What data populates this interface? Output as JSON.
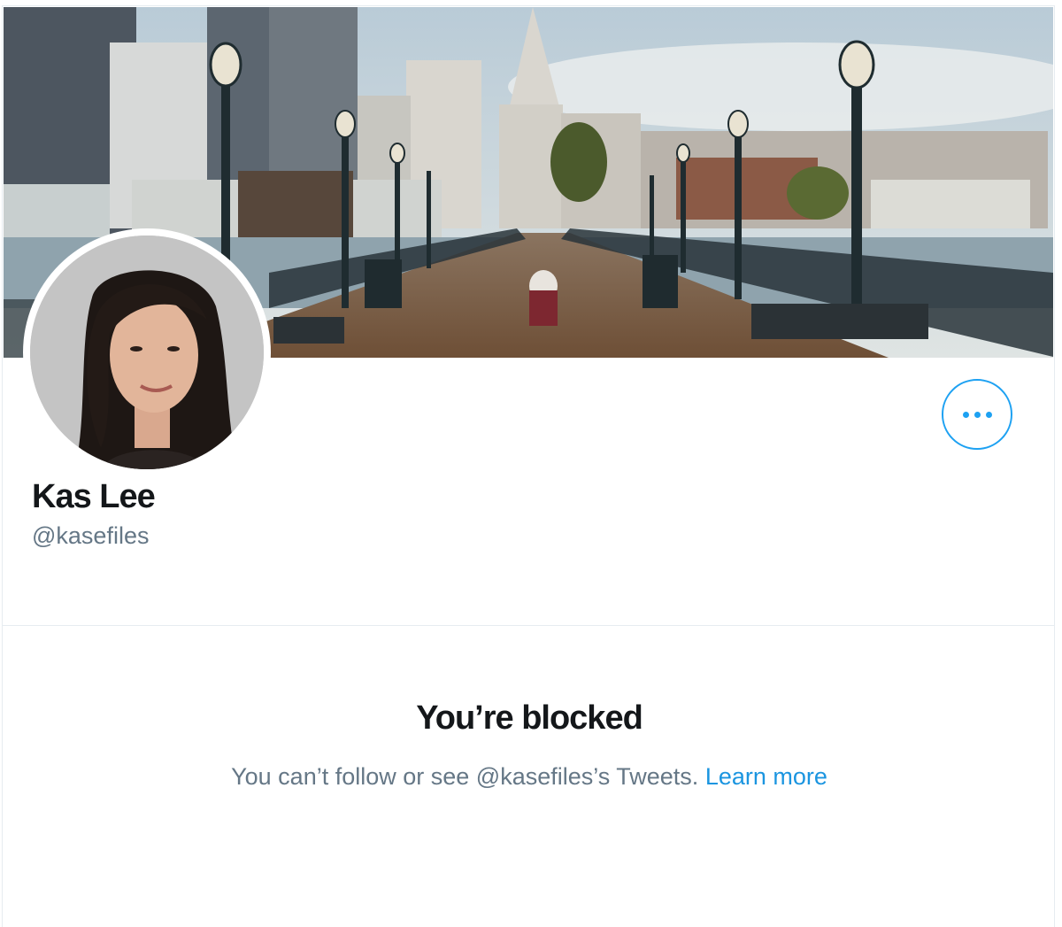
{
  "profile": {
    "name": "Kas Lee",
    "handle": "@kasefiles"
  },
  "actions": {
    "more_icon": "more-horizontal-icon"
  },
  "blocked": {
    "title": "You’re blocked",
    "message": "You can’t follow or see @kasefiles’s Tweets.",
    "link_text": "Learn more"
  },
  "colors": {
    "accent": "#1da1f2",
    "link": "#1b95e0",
    "text_primary": "#14171a",
    "text_secondary": "#657786",
    "border": "#e6ecf0"
  }
}
